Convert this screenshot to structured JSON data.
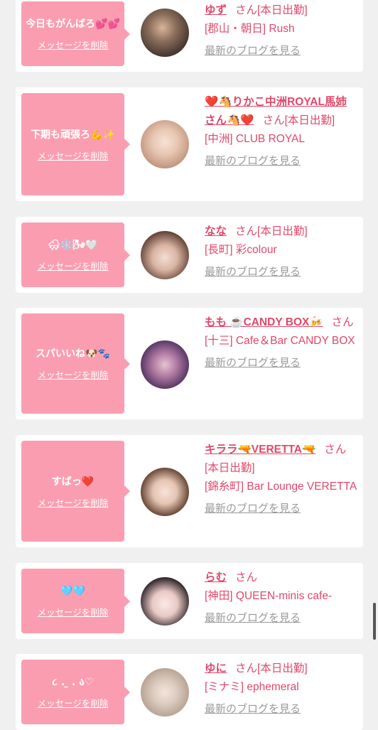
{
  "cards": [
    {
      "message": "今日もがんばろ💕💕",
      "delete_label": "メッセージを削除",
      "name": "ゆず",
      "honorific": "さん",
      "status": "[本日出勤]",
      "shop": "[郡山・朝日] Rush",
      "blog_label": "最新のブログを見る"
    },
    {
      "message": "下期も頑張ろ💪✨",
      "delete_label": "メッセージを削除",
      "name": "❤️🐴りかこ中洲ROYAL馬姉さん🐴❤️",
      "honorific": "さん",
      "status": "[本日出勤]",
      "shop": "[中洲] CLUB ROYAL",
      "blog_label": "最新のブログを見る"
    },
    {
      "message": "🌨❄️🌬🤍",
      "delete_label": "メッセージを削除",
      "name": "なな",
      "honorific": "さん",
      "status": "[本日出勤]",
      "shop": "[長町] 彩colour",
      "blog_label": "最新のブログを見る"
    },
    {
      "message": "スパいいね🐶🐾",
      "delete_label": "メッセージを削除",
      "name": "もも ☕CANDY BOX🍻",
      "honorific": "さん",
      "status": "",
      "shop": "[十三] Cafe＆Bar CANDY BOX",
      "blog_label": "最新のブログを見る"
    },
    {
      "message": "すばっ❤️",
      "delete_label": "メッセージを削除",
      "name": "キララ🔫VERETTA🔫",
      "honorific": "さん",
      "status": "[本日出勤]",
      "shop": "[錦糸町] Bar Lounge VERETTA",
      "blog_label": "最新のブログを見る"
    },
    {
      "message": "🩵🩵",
      "delete_label": "メッセージを削除",
      "name": "らむ",
      "honorific": "さん",
      "status": "",
      "shop": "[神田] QUEEN-minis cafe-",
      "blog_label": "最新のブログを見る"
    },
    {
      "message": "૮ . ̫ . ა♡",
      "delete_label": "メッセージを削除",
      "name": "ゆに",
      "honorific": "さん",
      "status": "[本日出勤]",
      "shop": "[ミナミ] ephemeral",
      "blog_label": "最新のブログを見る"
    }
  ],
  "colors": {
    "bubble": "#fb9db0",
    "accent": "#e0486a",
    "blog_link": "#9a9a9a",
    "page_bg": "#f0f0f0"
  }
}
